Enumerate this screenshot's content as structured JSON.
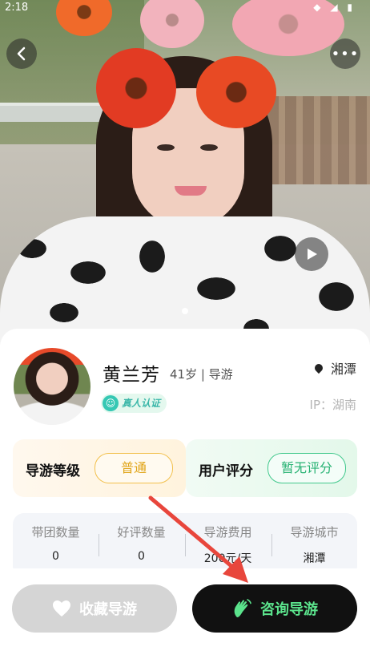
{
  "status_bar": {
    "time": "2:18",
    "icons": "◆ ◢ ▮"
  },
  "hero": {
    "more_label": "•••",
    "back_label": "‹"
  },
  "profile": {
    "name": "黄兰芳",
    "age_role": "41岁 | 导游",
    "verify_badge": "真人认证",
    "location": "湘潭",
    "ip": "IP：湖南"
  },
  "panels": {
    "level_label": "导游等级",
    "level_value": "普通",
    "rating_label": "用户评分",
    "rating_value": "暂无评分"
  },
  "stats": [
    {
      "label": "带团数量",
      "value": "0"
    },
    {
      "label": "好评数量",
      "value": "0"
    },
    {
      "label": "导游费用",
      "value": "200元/天"
    },
    {
      "label": "导游城市",
      "value": "湘潭"
    }
  ],
  "actions": {
    "favorite_label": "收藏导游",
    "consult_label": "咨询导游"
  },
  "colors": {
    "accent_green": "#5be38c",
    "level_gold": "#e0a417",
    "rating_green": "#27b273",
    "annotation_arrow": "#e8463c"
  },
  "icons": {
    "back": "back-arrow-icon",
    "more": "more-icon",
    "play": "play-icon",
    "pin": "location-pin-icon",
    "verify": "verify-face-icon",
    "favorite": "heart-icon",
    "consult": "waving-hand-icon"
  }
}
